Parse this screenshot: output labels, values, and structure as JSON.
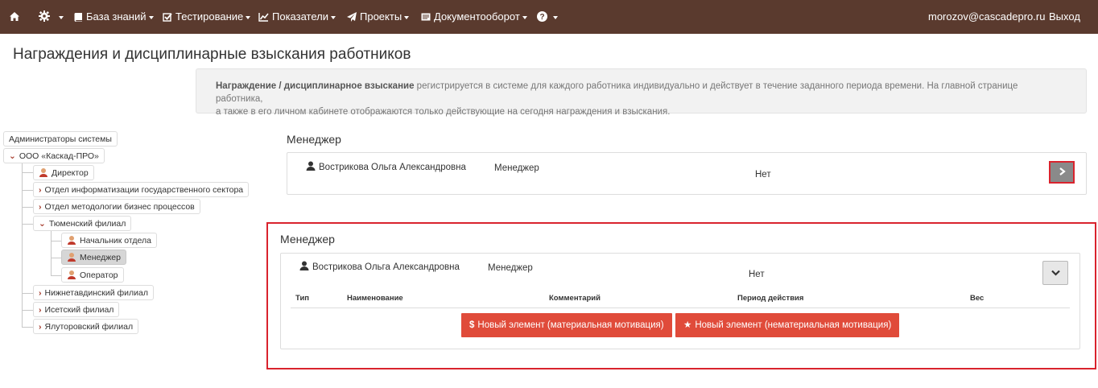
{
  "navbar": {
    "home_icon": "home-icon",
    "settings_icon": "gear-icon",
    "items": [
      {
        "label": "База знаний",
        "icon": "book-icon"
      },
      {
        "label": "Тестирование",
        "icon": "checkbox-icon"
      },
      {
        "label": "Показатели",
        "icon": "line-chart-icon"
      },
      {
        "label": "Проекты",
        "icon": "send-icon"
      },
      {
        "label": "Документооборот",
        "icon": "document-icon"
      }
    ],
    "help_icon": "question-icon",
    "user_email": "morozov@cascadepro.ru",
    "logout_label": "Выход",
    "bg_color": "#5a3a2e"
  },
  "page": {
    "title": "Награждения и дисциплинарные взыскания работников"
  },
  "info": {
    "bold": "Награждение / дисциплинарное взыскание",
    "text": " регистрируется в системе для каждого работника индивидуально и действует в течение заданного периода времени. На главной странице работника,",
    "text2": "а также в его личном кабинете отображаются только действующие на сегодня награждения и взыскания."
  },
  "tree": {
    "admins": "Администраторы системы",
    "org": "ООО «Каскад-ПРО»",
    "director": "Директор",
    "dept1": "Отдел информатизации государственного сектора",
    "dept2": "Отдел методологии бизнес процессов",
    "branch_tyumen": "Тюменский филиал",
    "head": "Начальник отдела",
    "manager": "Менеджер",
    "operator": "Оператор",
    "branch_nizhn": "Нижнетавдинский филиал",
    "branch_iset": "Исетский филиал",
    "branch_yalut": "Ялуторовский филиал"
  },
  "collapsed": {
    "title": "Менеджер",
    "employee": "Вострикова Ольга Александровна",
    "role": "Менеджер",
    "status": "Нет"
  },
  "expanded": {
    "title": "Менеджер",
    "employee": "Вострикова Ольга Александровна",
    "role": "Менеджер",
    "status": "Нет",
    "columns": [
      "Тип",
      "Наименование",
      "Комментарий",
      "Период действия",
      "Вес"
    ],
    "btn_material": "Новый элемент (материальная мотивация)",
    "btn_nonmaterial": "Новый элемент (нематериальная мотивация)",
    "btn_color": "#e04b3a",
    "highlight_color": "#d9232d"
  }
}
